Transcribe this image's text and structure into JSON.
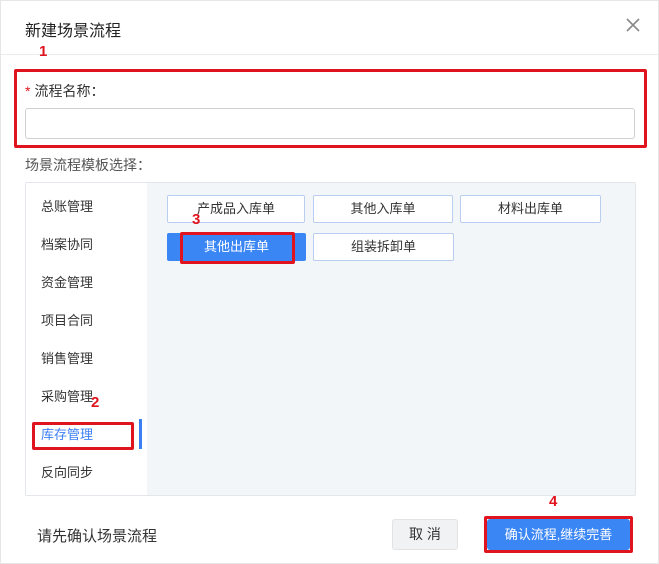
{
  "dialog": {
    "title": "新建场景流程",
    "close_icon": "close-icon"
  },
  "name_field": {
    "required_mark": "*",
    "label": "流程名称：",
    "value": "",
    "placeholder": ""
  },
  "template_section": {
    "label": "场景流程模板选择："
  },
  "sidebar": {
    "items": [
      {
        "label": "总账管理"
      },
      {
        "label": "档案协同"
      },
      {
        "label": "资金管理"
      },
      {
        "label": "项目合同"
      },
      {
        "label": "销售管理"
      },
      {
        "label": "采购管理"
      },
      {
        "label": "库存管理",
        "active": true
      },
      {
        "label": "反向同步"
      }
    ],
    "accent_color": "#3b7ff5"
  },
  "templates": [
    {
      "label": "产成品入库单"
    },
    {
      "label": "其他入库单"
    },
    {
      "label": "材料出库单"
    },
    {
      "label": "其他出库单",
      "selected": true
    },
    {
      "label": "组装拆卸单"
    }
  ],
  "footer": {
    "message": "请先确认场景流程",
    "cancel_label": "取 消",
    "confirm_label": "确认流程,继续完善"
  },
  "annotations": {
    "step1": "1",
    "step2": "2",
    "step3": "3",
    "step4": "4",
    "color": "#e0141f"
  }
}
